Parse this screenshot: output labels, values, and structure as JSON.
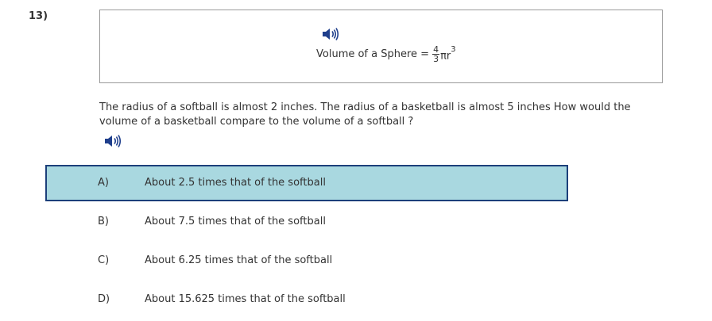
{
  "question": {
    "number": "13)",
    "formula": {
      "label": "Volume of a Sphere =",
      "numerator": "4",
      "denominator": "3",
      "expression": "πr",
      "exponent": "3"
    },
    "prompt": "The radius of a softball is almost 2 inches. The radius of a basketball is almost 5 inches How would the volume of a basketball compare to the volume of a softball ?"
  },
  "icons": {
    "formula_audio": "speaker-icon",
    "question_audio": "speaker-icon"
  },
  "options": [
    {
      "letter": "A)",
      "text": "About 2.5 times that of the softball",
      "selected": true
    },
    {
      "letter": "B)",
      "text": "About 7.5 times that of the softball",
      "selected": false
    },
    {
      "letter": "C)",
      "text": "About 6.25 times that of the softball",
      "selected": false
    },
    {
      "letter": "D)",
      "text": "About 15.625 times that of the softball",
      "selected": false
    }
  ],
  "colors": {
    "selected_fill": "#a9d8e0",
    "selected_border": "#1c3f7a",
    "icon": "#1f3f8c"
  }
}
